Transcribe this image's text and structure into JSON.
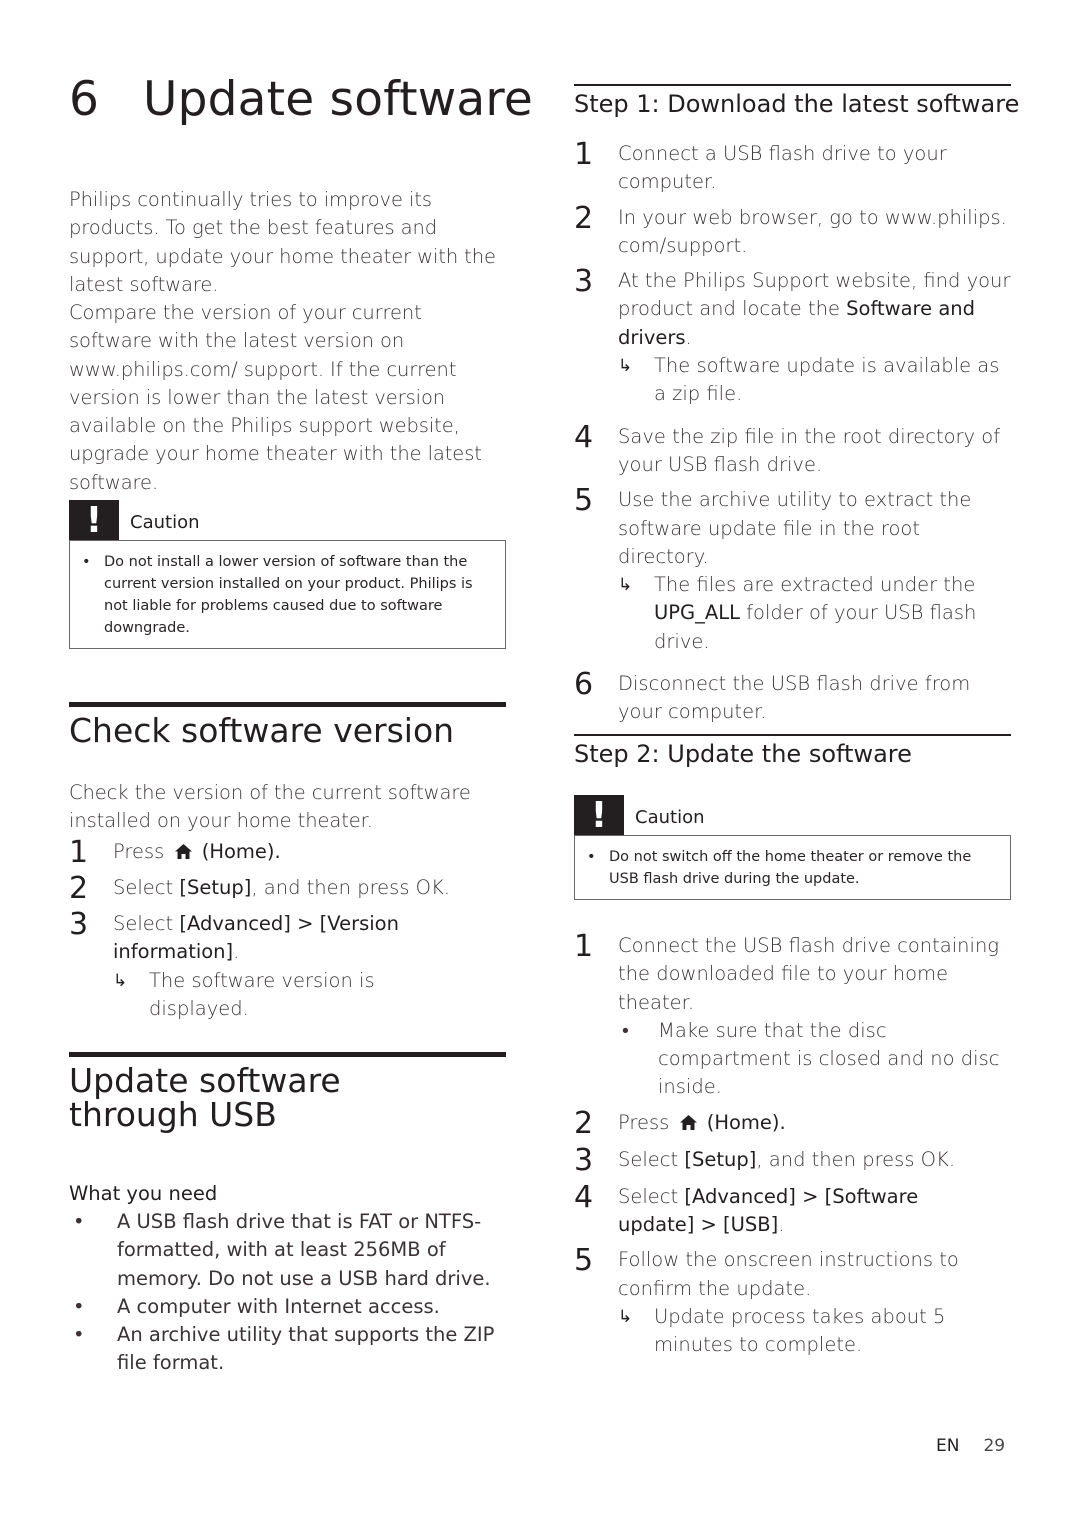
{
  "chapter": {
    "number": "6",
    "title": "Update software"
  },
  "intro": {
    "paragraph1": "Philips continually tries to improve its products. To get the best features and support, update your home theater with the latest software.",
    "paragraph2": "Compare the version of your current software with the latest version on www.philips.com/ support. If the current version is lower than the latest version available on the Philips support website, upgrade your home theater with the latest software."
  },
  "caution1": {
    "icon": "exclamation-icon",
    "label": "Caution",
    "text": "Do not install a lower version of software than the current version installed on your product. Philips is not liable for problems caused due to software downgrade."
  },
  "check_version": {
    "title": "Check software version",
    "intro": "Check the version of the current software installed on your home theater.",
    "steps": [
      {
        "num": "1",
        "pre": "Press",
        "icon": "home-icon",
        "post": "(Home)."
      },
      {
        "num": "2",
        "pre": "Select",
        "hl": "[Setup]",
        "post": ", and then press OK."
      },
      {
        "num": "3",
        "pre": "Select",
        "hl": "[Advanced] > [Version information]",
        "post": "."
      }
    ],
    "result": "The software version is displayed."
  },
  "usb_update": {
    "title": "Update software through USB",
    "what_you_need": "What you need",
    "needs": [
      "A USB flash drive that is FAT or NTFS-formatted, with at least 256MB of memory. Do not use a USB hard drive.",
      "A computer with Internet access.",
      "An archive utility that supports the ZIP file format."
    ]
  },
  "step1": {
    "title": "Step 1: Download the latest software",
    "items": [
      {
        "num": "1",
        "text": "Connect a USB flash drive to your computer."
      },
      {
        "num": "2",
        "text": "In your web browser, go to www.philips. com/support."
      },
      {
        "num": "3",
        "pre": "At the Philips Support website, find your product and locate the ",
        "hl": "Software and drivers",
        "post": ".",
        "result": "The software update is available as a zip file."
      },
      {
        "num": "4",
        "text": "Save the zip file in the root directory of your USB flash drive."
      },
      {
        "num": "5",
        "text": "Use the archive utility to extract the software update file in the root directory.",
        "result_pre": "The files are extracted under the ",
        "result_hl": "UPG_ALL",
        "result_post": " folder of your USB flash drive."
      },
      {
        "num": "6",
        "text": "Disconnect the USB flash drive from your computer."
      }
    ]
  },
  "step2": {
    "title": "Step 2: Update the software",
    "caution": {
      "icon": "exclamation-icon",
      "label": "Caution",
      "text": "Do not switch off the home theater or remove the USB flash drive during the update."
    },
    "items": [
      {
        "num": "1",
        "text": "Connect the USB flash drive containing the downloaded file to your home theater.",
        "bullet": "Make sure that the disc compartment is closed and no disc inside."
      },
      {
        "num": "2",
        "pre": "Press",
        "icon": "home-icon",
        "post": "(Home)."
      },
      {
        "num": "3",
        "pre": "Select",
        "hl": "[Setup]",
        "post": ", and then press OK."
      },
      {
        "num": "4",
        "pre": "Select",
        "hl": "[Advanced] > [Software update] > [USB]",
        "post": "."
      },
      {
        "num": "5",
        "text": "Follow the onscreen instructions to confirm the update.",
        "result": "Update process takes about 5 minutes to complete."
      }
    ]
  },
  "footer": {
    "language": "EN",
    "page_number": "29"
  }
}
